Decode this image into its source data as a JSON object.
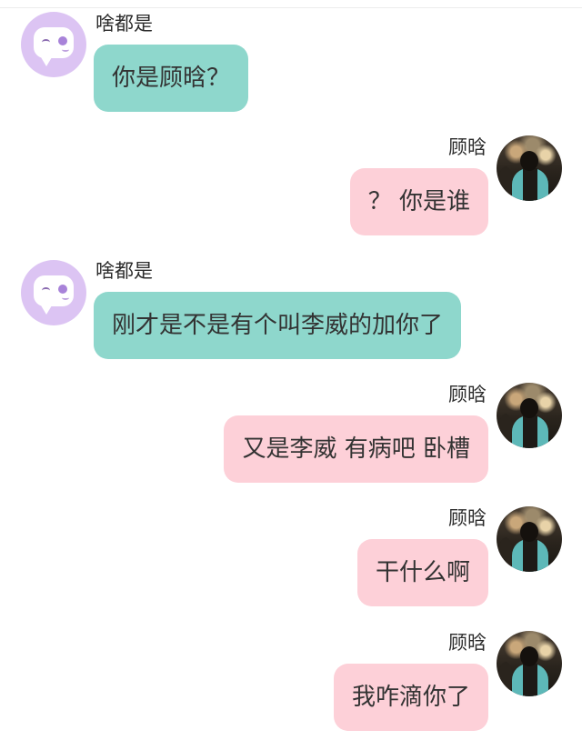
{
  "messages": [
    {
      "side": "left",
      "sender": "啥都是",
      "text": "你是顾晗？"
    },
    {
      "side": "right",
      "sender": "顾晗",
      "text": "？ 你是谁"
    },
    {
      "side": "left",
      "sender": "啥都是",
      "text": "刚才是不是有个叫李威的加你了"
    },
    {
      "side": "right",
      "sender": "顾晗",
      "text": "又是李威 有病吧 卧槽"
    },
    {
      "side": "right",
      "sender": "顾晗",
      "text": "干什么啊"
    },
    {
      "side": "right",
      "sender": "顾晗",
      "text": "我咋滴你了"
    }
  ],
  "colors": {
    "left_bubble": "#8ed7cc",
    "right_bubble": "#fdd0d8",
    "bot_avatar": "#dcc4f3"
  }
}
